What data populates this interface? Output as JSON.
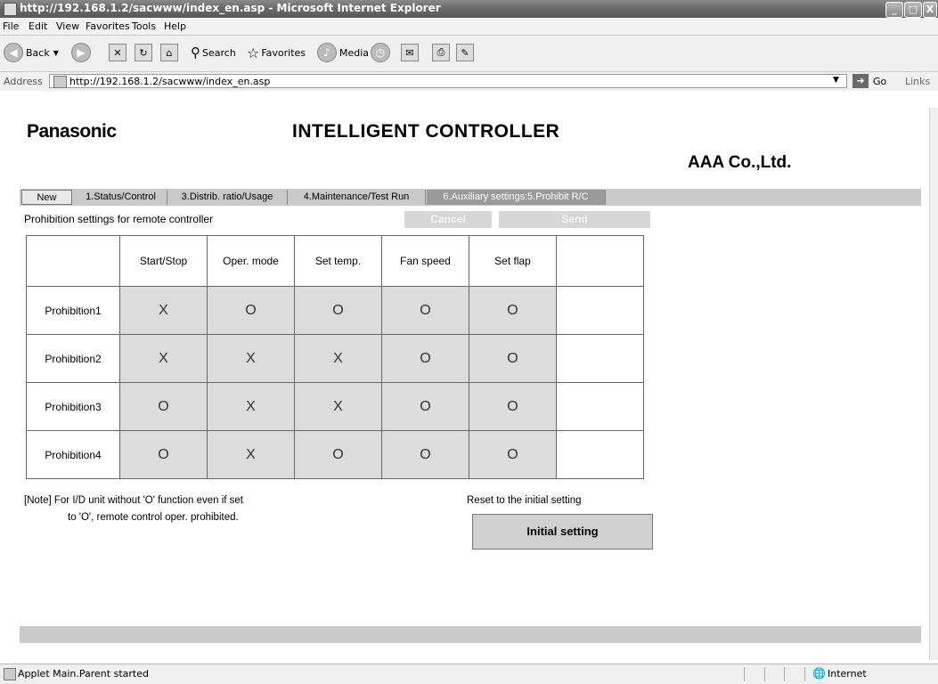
{
  "window": {
    "title": "http://192.168.1.2/sacwww/index_en.asp - Microsoft Internet Explorer",
    "minimize": "_",
    "maximize": "□",
    "close": "X"
  },
  "menu": [
    "File",
    "Edit",
    "View",
    "Favorites",
    "Tools",
    "Help"
  ],
  "toolbar": {
    "back": "Back",
    "search": "Search",
    "favorites": "Favorites",
    "media": "Media"
  },
  "address": {
    "label": "Address",
    "url": "http://192.168.1.2/sacwww/index_en.asp",
    "go": "Go",
    "links": "Links"
  },
  "page": {
    "logo": "Panasonic",
    "heading": "INTELLIGENT CONTROLLER",
    "company": "AAA Co.,Ltd.",
    "tabs": [
      "New",
      "1.Status/Control",
      "3.Distrib. ratio/Usage",
      "4.Maintenance/Test Run",
      "6.Auxiliary settings:5.Prohibit R/C"
    ],
    "section_title": "Prohibition settings for remote controller",
    "cancel": "Cancel",
    "send": "Send",
    "table": {
      "headers": [
        "",
        "Start/Stop",
        "Oper. mode",
        "Set temp.",
        "Fan speed",
        "Set flap",
        ""
      ],
      "rows": [
        {
          "label": "Prohibition1",
          "values": [
            "X",
            "O",
            "O",
            "O",
            "O"
          ]
        },
        {
          "label": "Prohibition2",
          "values": [
            "X",
            "X",
            "X",
            "O",
            "O"
          ]
        },
        {
          "label": "Prohibition3",
          "values": [
            "O",
            "X",
            "X",
            "O",
            "O"
          ]
        },
        {
          "label": "Prohibition4",
          "values": [
            "O",
            "X",
            "O",
            "O",
            "O"
          ]
        }
      ]
    },
    "note_line1": "[Note] For I/D unit without 'O' function even if set",
    "note_line2": "to 'O', remote control oper. prohibited.",
    "reset_label": "Reset to the initial setting",
    "initial_setting": "Initial setting"
  },
  "status": {
    "text": "Applet Main.Parent started",
    "zone": "Internet"
  }
}
